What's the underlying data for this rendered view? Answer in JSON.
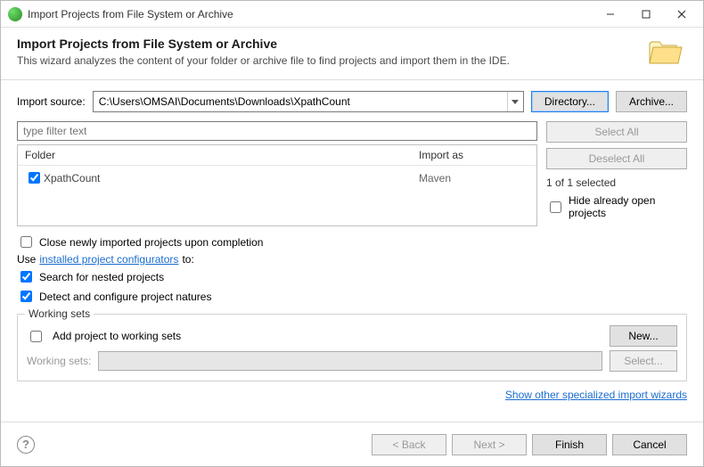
{
  "window": {
    "title": "Import Projects from File System or Archive"
  },
  "header": {
    "title": "Import Projects from File System or Archive",
    "subtitle": "This wizard analyzes the content of your folder or archive file to find projects and import them in the IDE."
  },
  "source": {
    "label": "Import source:",
    "value": "C:\\Users\\OMSAI\\Documents\\Downloads\\XpathCount",
    "directory_btn": "Directory...",
    "archive_btn": "Archive..."
  },
  "filter_placeholder": "type filter text",
  "table": {
    "col_folder": "Folder",
    "col_import": "Import as",
    "rows": [
      {
        "name": "XpathCount",
        "import_as": "Maven",
        "checked": true
      }
    ]
  },
  "right": {
    "select_all": "Select All",
    "deselect_all": "Deselect All",
    "count": "1 of 1 selected",
    "hide_open": "Hide already open projects"
  },
  "options": {
    "close_new": "Close newly imported projects upon completion",
    "use_prefix": "Use ",
    "configurators_link": "installed project configurators",
    "use_suffix": " to:",
    "nested": "Search for nested projects",
    "detect": "Detect and configure project natures"
  },
  "working_sets": {
    "legend": "Working sets",
    "add": "Add project to working sets",
    "new_btn": "New...",
    "label": "Working sets:",
    "select_btn": "Select..."
  },
  "special_link": "Show other specialized import wizards",
  "footer": {
    "back": "< Back",
    "next": "Next >",
    "finish": "Finish",
    "cancel": "Cancel"
  }
}
